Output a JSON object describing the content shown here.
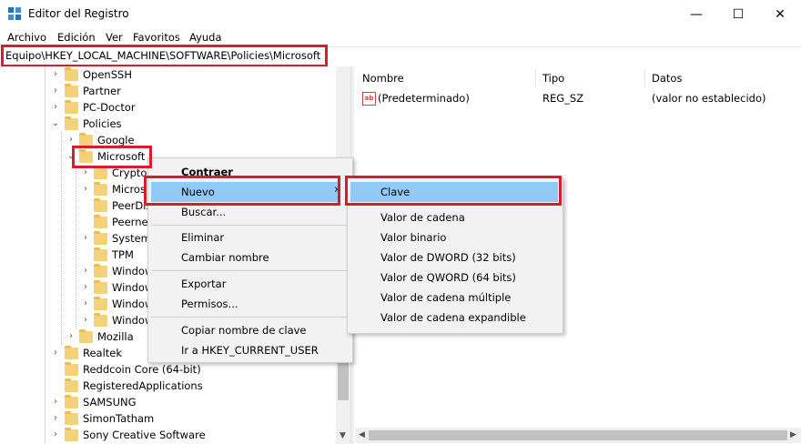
{
  "window": {
    "title": "Editor del Registro",
    "minimize": "—",
    "maximize": "☐",
    "close": "✕"
  },
  "menu": [
    "Archivo",
    "Edición",
    "Ver",
    "Favoritos",
    "Ayuda"
  ],
  "address": "Equipo\\HKEY_LOCAL_MACHINE\\SOFTWARE\\Policies\\Microsoft",
  "tree": {
    "items": [
      {
        "label": "OpenSSH",
        "level": 0,
        "state": "collapsed"
      },
      {
        "label": "Partner",
        "level": 0,
        "state": "collapsed"
      },
      {
        "label": "PC-Doctor",
        "level": 0,
        "state": "collapsed"
      },
      {
        "label": "Policies",
        "level": 0,
        "state": "expanded"
      },
      {
        "label": "Google",
        "level": 1,
        "state": "collapsed"
      },
      {
        "label": "Microsoft",
        "level": 1,
        "state": "expanded"
      },
      {
        "label": "Crypto",
        "level": 2,
        "state": "collapsed"
      },
      {
        "label": "Micros",
        "level": 2,
        "state": "collapsed"
      },
      {
        "label": "PeerDis",
        "level": 2,
        "state": "none"
      },
      {
        "label": "Peernet",
        "level": 2,
        "state": "none"
      },
      {
        "label": "System",
        "level": 2,
        "state": "collapsed"
      },
      {
        "label": "TPM",
        "level": 2,
        "state": "none"
      },
      {
        "label": "Window",
        "level": 2,
        "state": "collapsed"
      },
      {
        "label": "Window",
        "level": 2,
        "state": "collapsed"
      },
      {
        "label": "Window",
        "level": 2,
        "state": "collapsed"
      },
      {
        "label": "Window",
        "level": 2,
        "state": "collapsed"
      },
      {
        "label": "Mozilla",
        "level": 1,
        "state": "collapsed"
      },
      {
        "label": "Realtek",
        "level": 0,
        "state": "collapsed"
      },
      {
        "label": "Reddcoin Core (64-bit)",
        "level": 0,
        "state": "none"
      },
      {
        "label": "RegisteredApplications",
        "level": 0,
        "state": "none"
      },
      {
        "label": "SAMSUNG",
        "level": 0,
        "state": "collapsed"
      },
      {
        "label": "SimonTatham",
        "level": 0,
        "state": "collapsed"
      },
      {
        "label": "Sony Creative Software",
        "level": 0,
        "state": "collapsed"
      }
    ]
  },
  "columns": {
    "name": "Nombre",
    "type": "Tipo",
    "data": "Datos"
  },
  "values": [
    {
      "name": "(Predeterminado)",
      "type": "REG_SZ",
      "data": "(valor no establecido)",
      "icon": "ab"
    }
  ],
  "context_menu": {
    "items": [
      "Contraer",
      "Nuevo",
      "Buscar...",
      "Eliminar",
      "Cambiar nombre",
      "Exportar",
      "Permisos...",
      "Copiar nombre de clave",
      "Ir a HKEY_CURRENT_USER"
    ],
    "submenu_arrow": "›"
  },
  "submenu": {
    "items": [
      "Clave",
      "Valor de cadena",
      "Valor binario",
      "Valor de DWORD (32 bits)",
      "Valor de QWORD (64 bits)",
      "Valor de cadena múltiple",
      "Valor de cadena expandible"
    ]
  },
  "colors": {
    "highlight": "#91c9f7",
    "callout_red": "#d41e2b",
    "folder": "#f3d27a"
  }
}
